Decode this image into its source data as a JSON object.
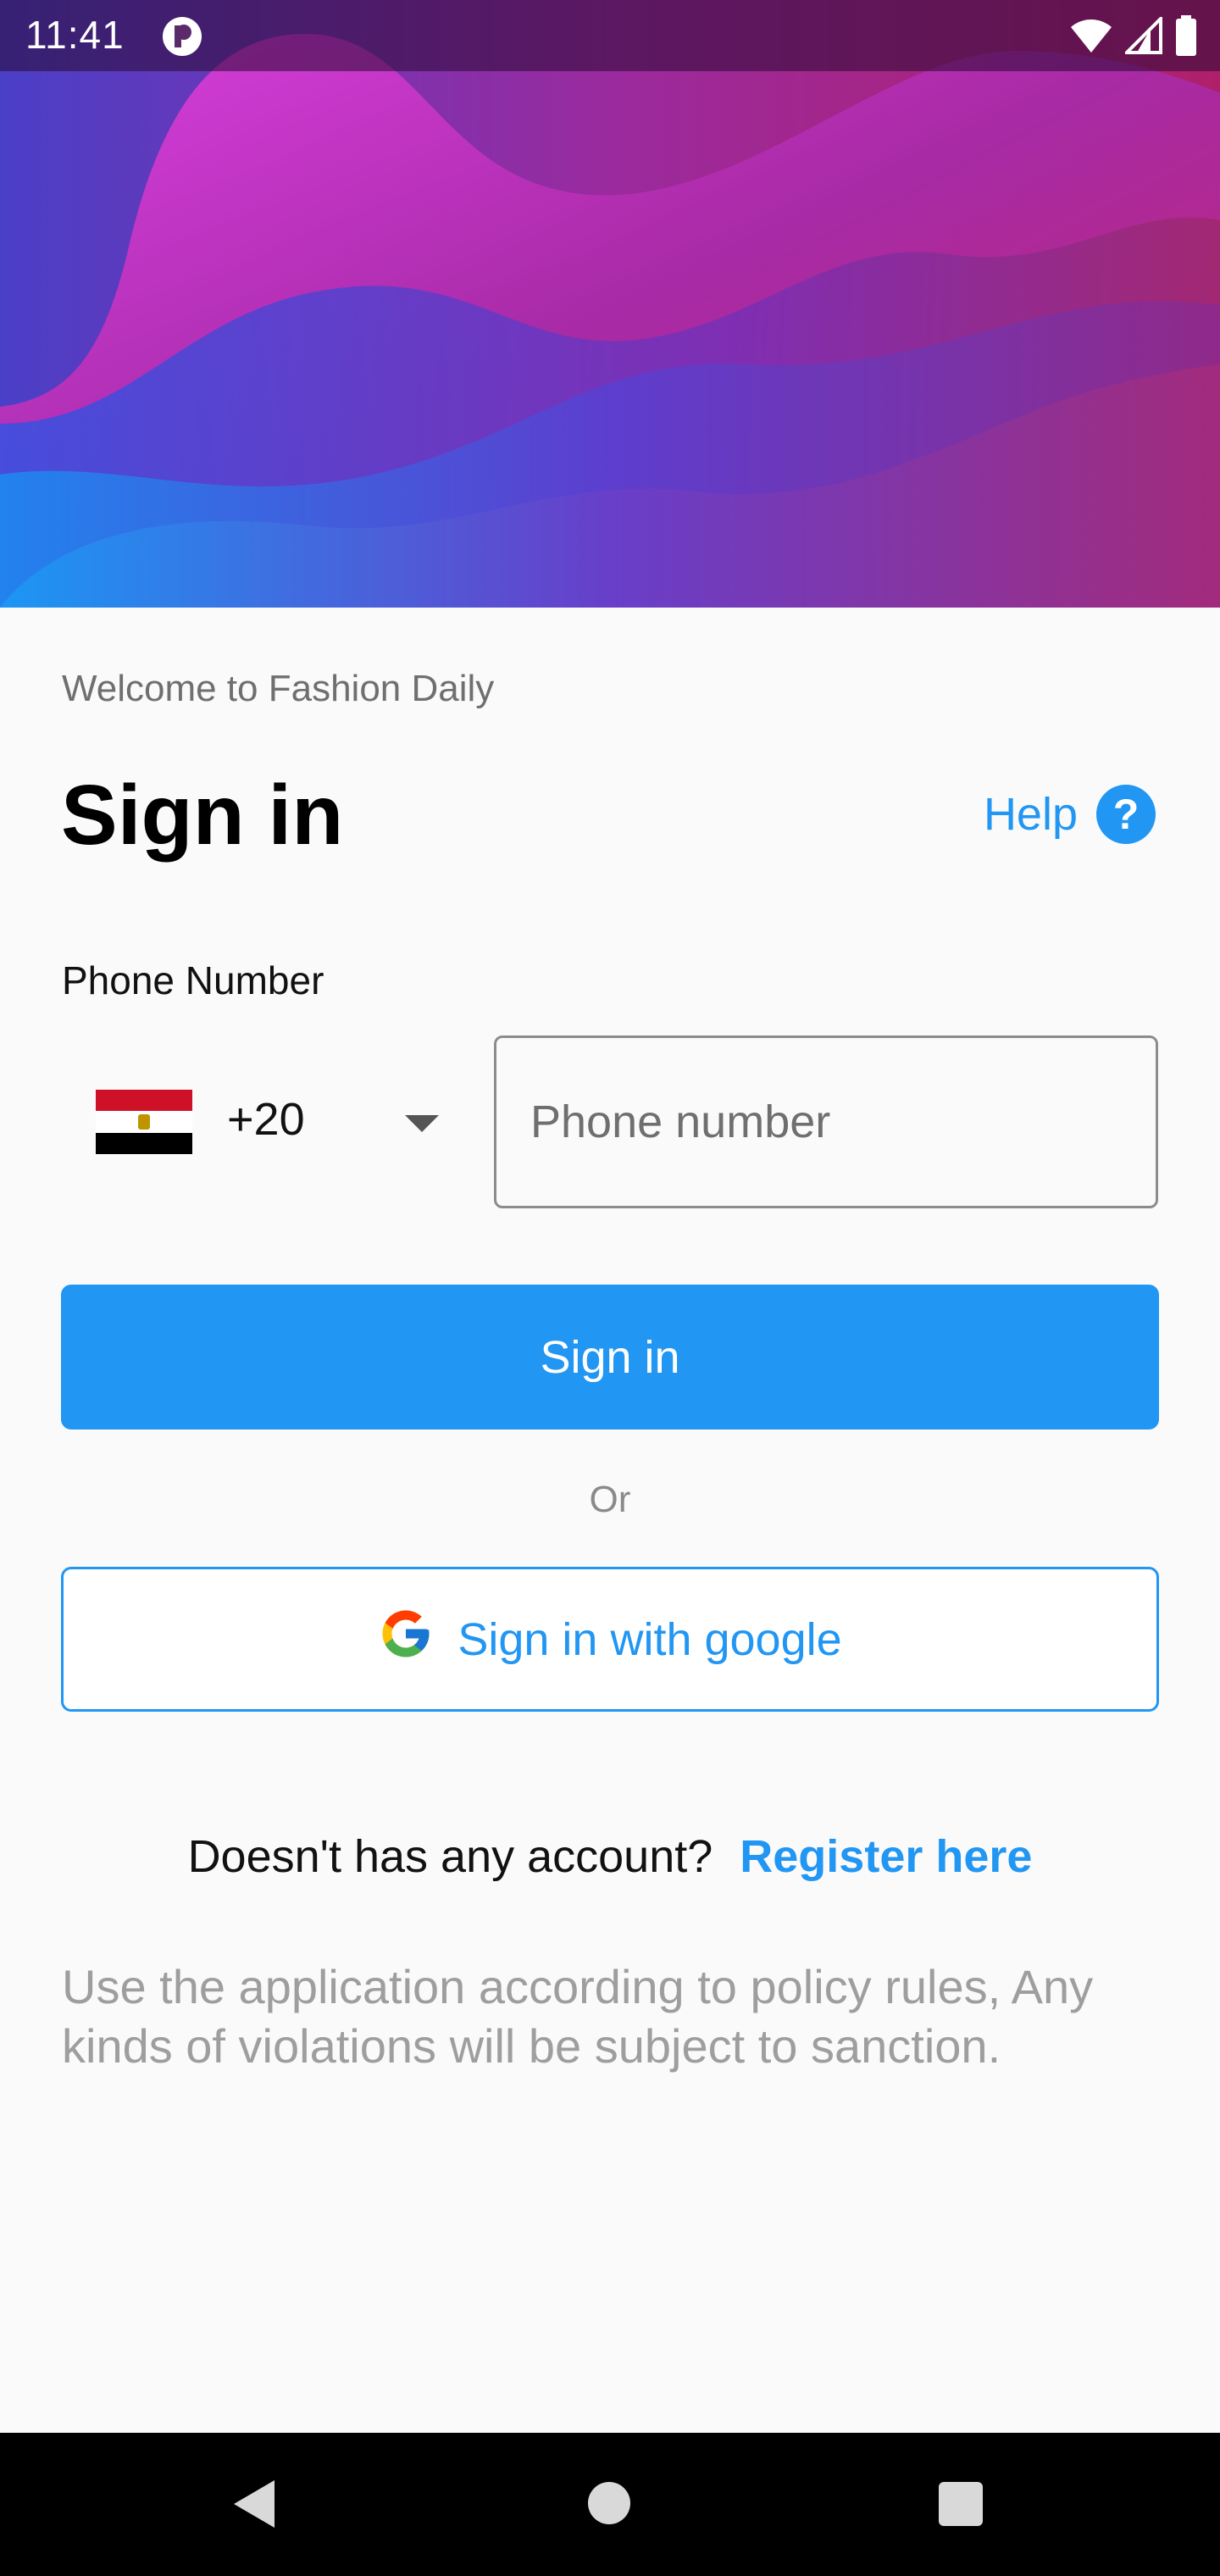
{
  "status_bar": {
    "time": "11:41",
    "app_icon": "app-notification-icon",
    "right_icons": [
      "wifi-icon",
      "cellular-signal-icon",
      "battery-icon"
    ]
  },
  "header": {
    "welcome": "Welcome to Fashion Daily",
    "title": "Sign in",
    "help_label": "Help",
    "help_glyph": "?"
  },
  "phone": {
    "label": "Phone Number",
    "country_code": "+20",
    "country_flag": "egypt-flag-icon",
    "placeholder": "Phone number",
    "value": ""
  },
  "buttons": {
    "signin": "Sign in",
    "or": "Or",
    "google": "Sign in with google"
  },
  "register": {
    "question": "Doesn't has any account?",
    "link": "Register here"
  },
  "policy": "Use the application according to policy rules, Any kinds of violations will be subject to sanction.",
  "colors": {
    "accent": "#2196f3",
    "background": "#fafafa",
    "flag_red": "#ce1126",
    "flag_white": "#ffffff",
    "flag_black": "#000000"
  },
  "nav_bar": [
    "back-icon",
    "home-icon",
    "recents-icon"
  ]
}
